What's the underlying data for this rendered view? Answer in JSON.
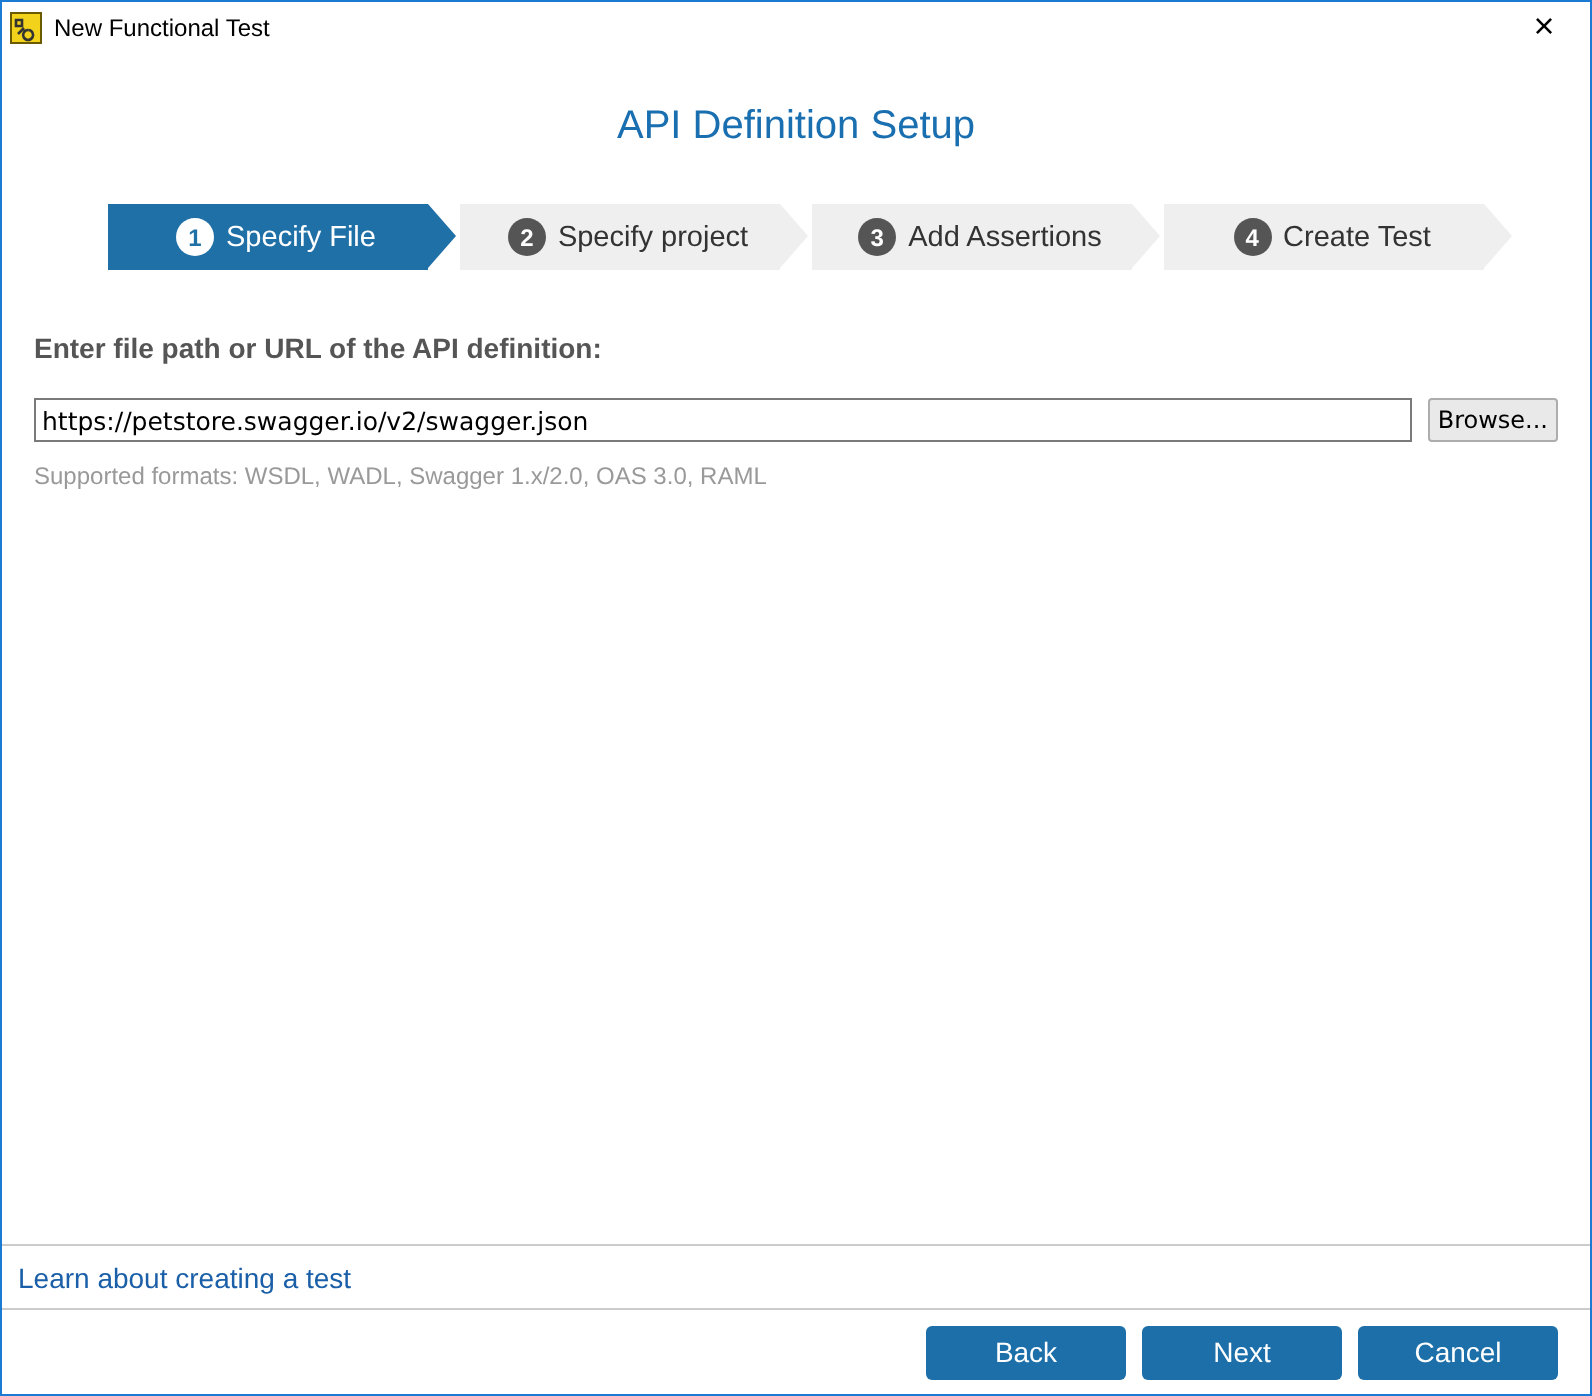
{
  "window": {
    "title": "New Functional Test",
    "close": "×"
  },
  "heading": "API Definition Setup",
  "steps": [
    {
      "number": "1",
      "label": "Specify File",
      "selected": true
    },
    {
      "number": "2",
      "label": "Specify project",
      "selected": false
    },
    {
      "number": "3",
      "label": "Add Assertions",
      "selected": false
    },
    {
      "number": "4",
      "label": "Create Test",
      "selected": false
    }
  ],
  "field_label": "Enter file path or URL of the API definition:",
  "path_field": {
    "value": "https://petstore.swagger.io/v2/swagger.json"
  },
  "browse_button": "Browse...",
  "hint": "Supported formats: WSDL, WADL, Swagger 1.x/2.0, OAS 3.0, RAML",
  "help_link": "Learn about creating a test",
  "buttons": [
    "Back",
    "Next",
    "Cancel"
  ]
}
